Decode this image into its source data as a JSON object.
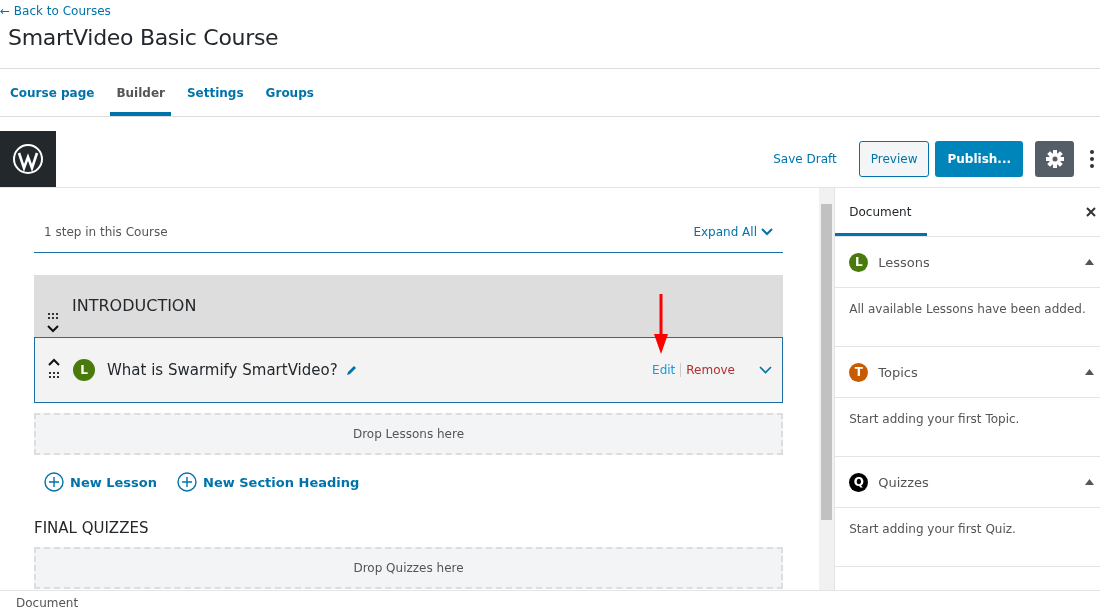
{
  "back_link": "← Back to Courses",
  "title": "SmartVideo Basic Course",
  "tabs": [
    {
      "label": "Course page",
      "selected": false
    },
    {
      "label": "Builder",
      "selected": true
    },
    {
      "label": "Settings",
      "selected": false
    },
    {
      "label": "Groups",
      "selected": false
    }
  ],
  "toolbar": {
    "save_draft": "Save Draft",
    "preview": "Preview",
    "publish": "Publish..."
  },
  "builder": {
    "step_count": "1 step in this Course",
    "expand_all": "Expand All",
    "section": {
      "title": "INTRODUCTION"
    },
    "lesson": {
      "badge": "L",
      "title": "What is Swarmify SmartVideo?",
      "edit": "Edit",
      "remove": "Remove"
    },
    "drop_lessons": "Drop Lessons here",
    "add_buttons": [
      "New Lesson",
      "New Section Heading"
    ],
    "final_heading": "FINAL QUIZZES",
    "drop_quizzes": "Drop Quizzes here"
  },
  "sidebar": {
    "tab": "Document",
    "panels": [
      {
        "badge": "L",
        "title": "Lessons",
        "color": "#4a7a0b",
        "message": "All available Lessons have been added."
      },
      {
        "badge": "T",
        "title": "Topics",
        "color": "#c85a00",
        "message": "Start adding your first Topic."
      },
      {
        "badge": "Q",
        "title": "Quizzes",
        "color": "#000000",
        "message": "Start adding your first Quiz."
      }
    ]
  },
  "status_bar": "Document"
}
